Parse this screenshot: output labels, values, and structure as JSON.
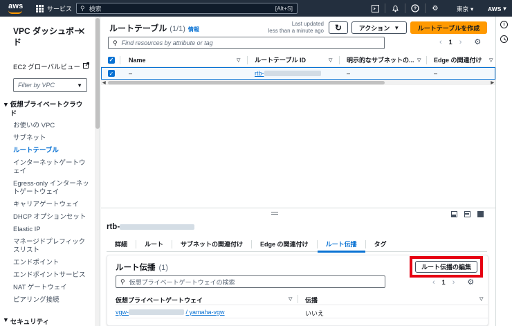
{
  "topbar": {
    "logo_text": "aws",
    "services_label": "サービス",
    "search_placeholder": "検索",
    "search_shortcut": "[Alt+S]",
    "region": "東京",
    "account": "AWS"
  },
  "sidebar": {
    "title": "VPC ダッシュボード",
    "global_view_link": "EC2 グローバルビュー",
    "filter_placeholder": "Filter by VPC",
    "section_private_cloud": "仮想プライベートクラウド",
    "items": [
      {
        "label": "お使いの VPC",
        "active": false
      },
      {
        "label": "サブネット",
        "active": false
      },
      {
        "label": "ルートテーブル",
        "active": true
      },
      {
        "label": "インターネットゲートウェイ",
        "active": false
      },
      {
        "label": "Egress-only インターネットゲートウェイ",
        "active": false
      },
      {
        "label": "キャリアゲートウェイ",
        "active": false
      },
      {
        "label": "DHCP オプションセット",
        "active": false
      },
      {
        "label": "Elastic IP",
        "active": false
      },
      {
        "label": "マネージドプレフィックスリスト",
        "active": false
      },
      {
        "label": "エンドポイント",
        "active": false
      },
      {
        "label": "エンドポイントサービス",
        "active": false
      },
      {
        "label": "NAT ゲートウェイ",
        "active": false
      },
      {
        "label": "ピアリング接続",
        "active": false
      }
    ],
    "section_security": "セキュリティ"
  },
  "route_tables": {
    "title": "ルートテーブル",
    "count": "(1/1)",
    "info_label": "情報",
    "last_updated": "Last updated",
    "last_updated_time": "less than a minute ago",
    "actions_label": "アクション",
    "create_label": "ルートテーブルを作成",
    "search_placeholder": "Find resources by attribute or tag",
    "page": "1",
    "columns": [
      "Name",
      "ルートテーブル ID",
      "明示的なサブネットの...",
      "Edge の関連付け"
    ],
    "rows": [
      {
        "name": "–",
        "id_prefix": "rtb-",
        "subnet": "–",
        "edge": "–"
      }
    ]
  },
  "detail": {
    "title_prefix": "rtb-",
    "tabs": [
      {
        "label": "詳細",
        "active": false
      },
      {
        "label": "ルート",
        "active": false
      },
      {
        "label": "サブネットの関連付け",
        "active": false
      },
      {
        "label": "Edge の関連付け",
        "active": false
      },
      {
        "label": "ルート伝播",
        "active": true
      },
      {
        "label": "タグ",
        "active": false
      }
    ],
    "propagation": {
      "title": "ルート伝播",
      "count": "(1)",
      "edit_label": "ルート伝播の編集",
      "search_placeholder": "仮想プライベートゲートウェイの検索",
      "page": "1",
      "columns": [
        "仮想プライベートゲートウェイ",
        "伝播"
      ],
      "rows": [
        {
          "gateway_prefix": "vgw-",
          "gateway_suffix": "/ yamaha-vgw",
          "propagation": "いいえ"
        }
      ]
    }
  },
  "colors": {
    "topbar": "#232f3e",
    "accent": "#0972d3",
    "primary_button": "#ff9900",
    "highlight_box": "#e60012"
  }
}
